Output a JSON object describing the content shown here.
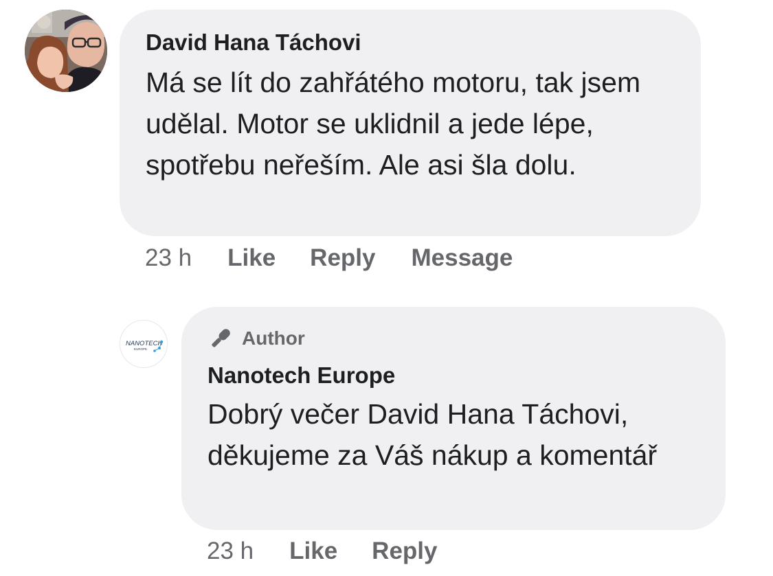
{
  "comments": [
    {
      "author": "David Hana Táchovi",
      "text": "Má se lít do zahřátého motoru, tak jsem udělal. Motor se uklidnil a jede lépe, spotřebu neřeším. Ale asi šla dolu.",
      "avatar_icon": "profile-photo-couple",
      "time": "23 h",
      "actions": {
        "like": "Like",
        "reply": "Reply",
        "message": "Message"
      }
    },
    {
      "badge": {
        "icon": "microphone-icon",
        "label": "Author"
      },
      "author": "Nanotech Europe",
      "text": "Dobrý večer David Hana Táchovi, děkujeme za Váš nákup a komentář",
      "avatar_icon": "nanotech-europe-logo",
      "avatar_logo_text": "NANOTECH",
      "avatar_logo_subtext": "EUROPE",
      "time": "23 h",
      "actions": {
        "like": "Like",
        "reply": "Reply"
      }
    }
  ],
  "colors": {
    "bubble": "#f0f0f2",
    "text": "#1c1e21",
    "secondary": "#65676b"
  }
}
